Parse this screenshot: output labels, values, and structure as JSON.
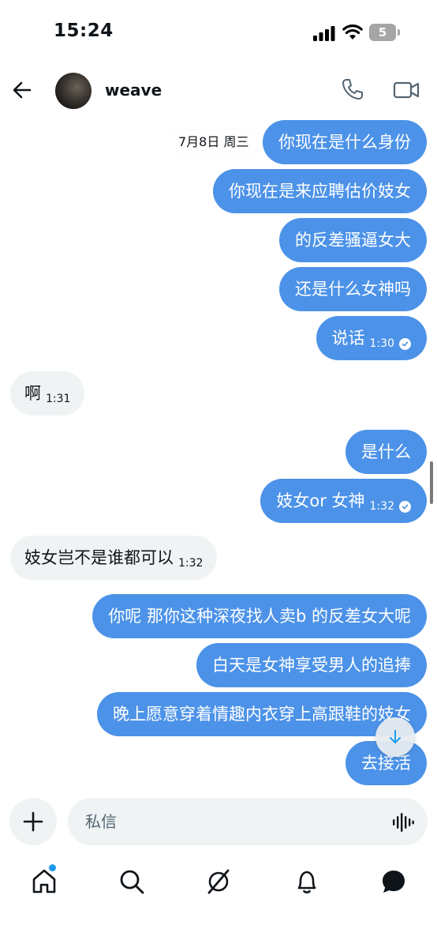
{
  "status_bar": {
    "time": "15:24",
    "battery": "5"
  },
  "header": {
    "contact_name": "weave"
  },
  "date_divider": "7月8日 周三",
  "messages": [
    {
      "dir": "out",
      "text": "你现在是什么身份"
    },
    {
      "dir": "out",
      "text": "你现在是来应聘估价妓女"
    },
    {
      "dir": "out",
      "text": "的反差骚逼女大"
    },
    {
      "dir": "out",
      "text": "还是什么女神吗"
    },
    {
      "dir": "out",
      "text": "说话",
      "time": "1:30",
      "read": true
    },
    {
      "dir": "in",
      "text": "啊",
      "time": "1:31"
    },
    {
      "dir": "out",
      "text": "是什么"
    },
    {
      "dir": "out",
      "text": "妓女or 女神",
      "time": "1:32",
      "read": true
    },
    {
      "dir": "in",
      "text": "妓女岂不是谁都可以",
      "time": "1:32"
    },
    {
      "dir": "out",
      "text": "你呢 那你这种深夜找人卖b 的反差女大呢"
    },
    {
      "dir": "out",
      "text": "白天是女神享受男人的追捧"
    },
    {
      "dir": "out",
      "text": "晚上愿意穿着情趣内衣穿上高跟鞋的妓女"
    },
    {
      "dir": "out",
      "text": "去接活"
    }
  ],
  "composer": {
    "placeholder": "私信"
  },
  "tabs": [
    "home-icon",
    "search-icon",
    "grok-icon",
    "notifications-icon",
    "messages-icon"
  ],
  "colors": {
    "outgoing_bubble": "#4c92e8",
    "incoming_bubble": "#eff3f4",
    "accent": "#1d9bf0"
  }
}
